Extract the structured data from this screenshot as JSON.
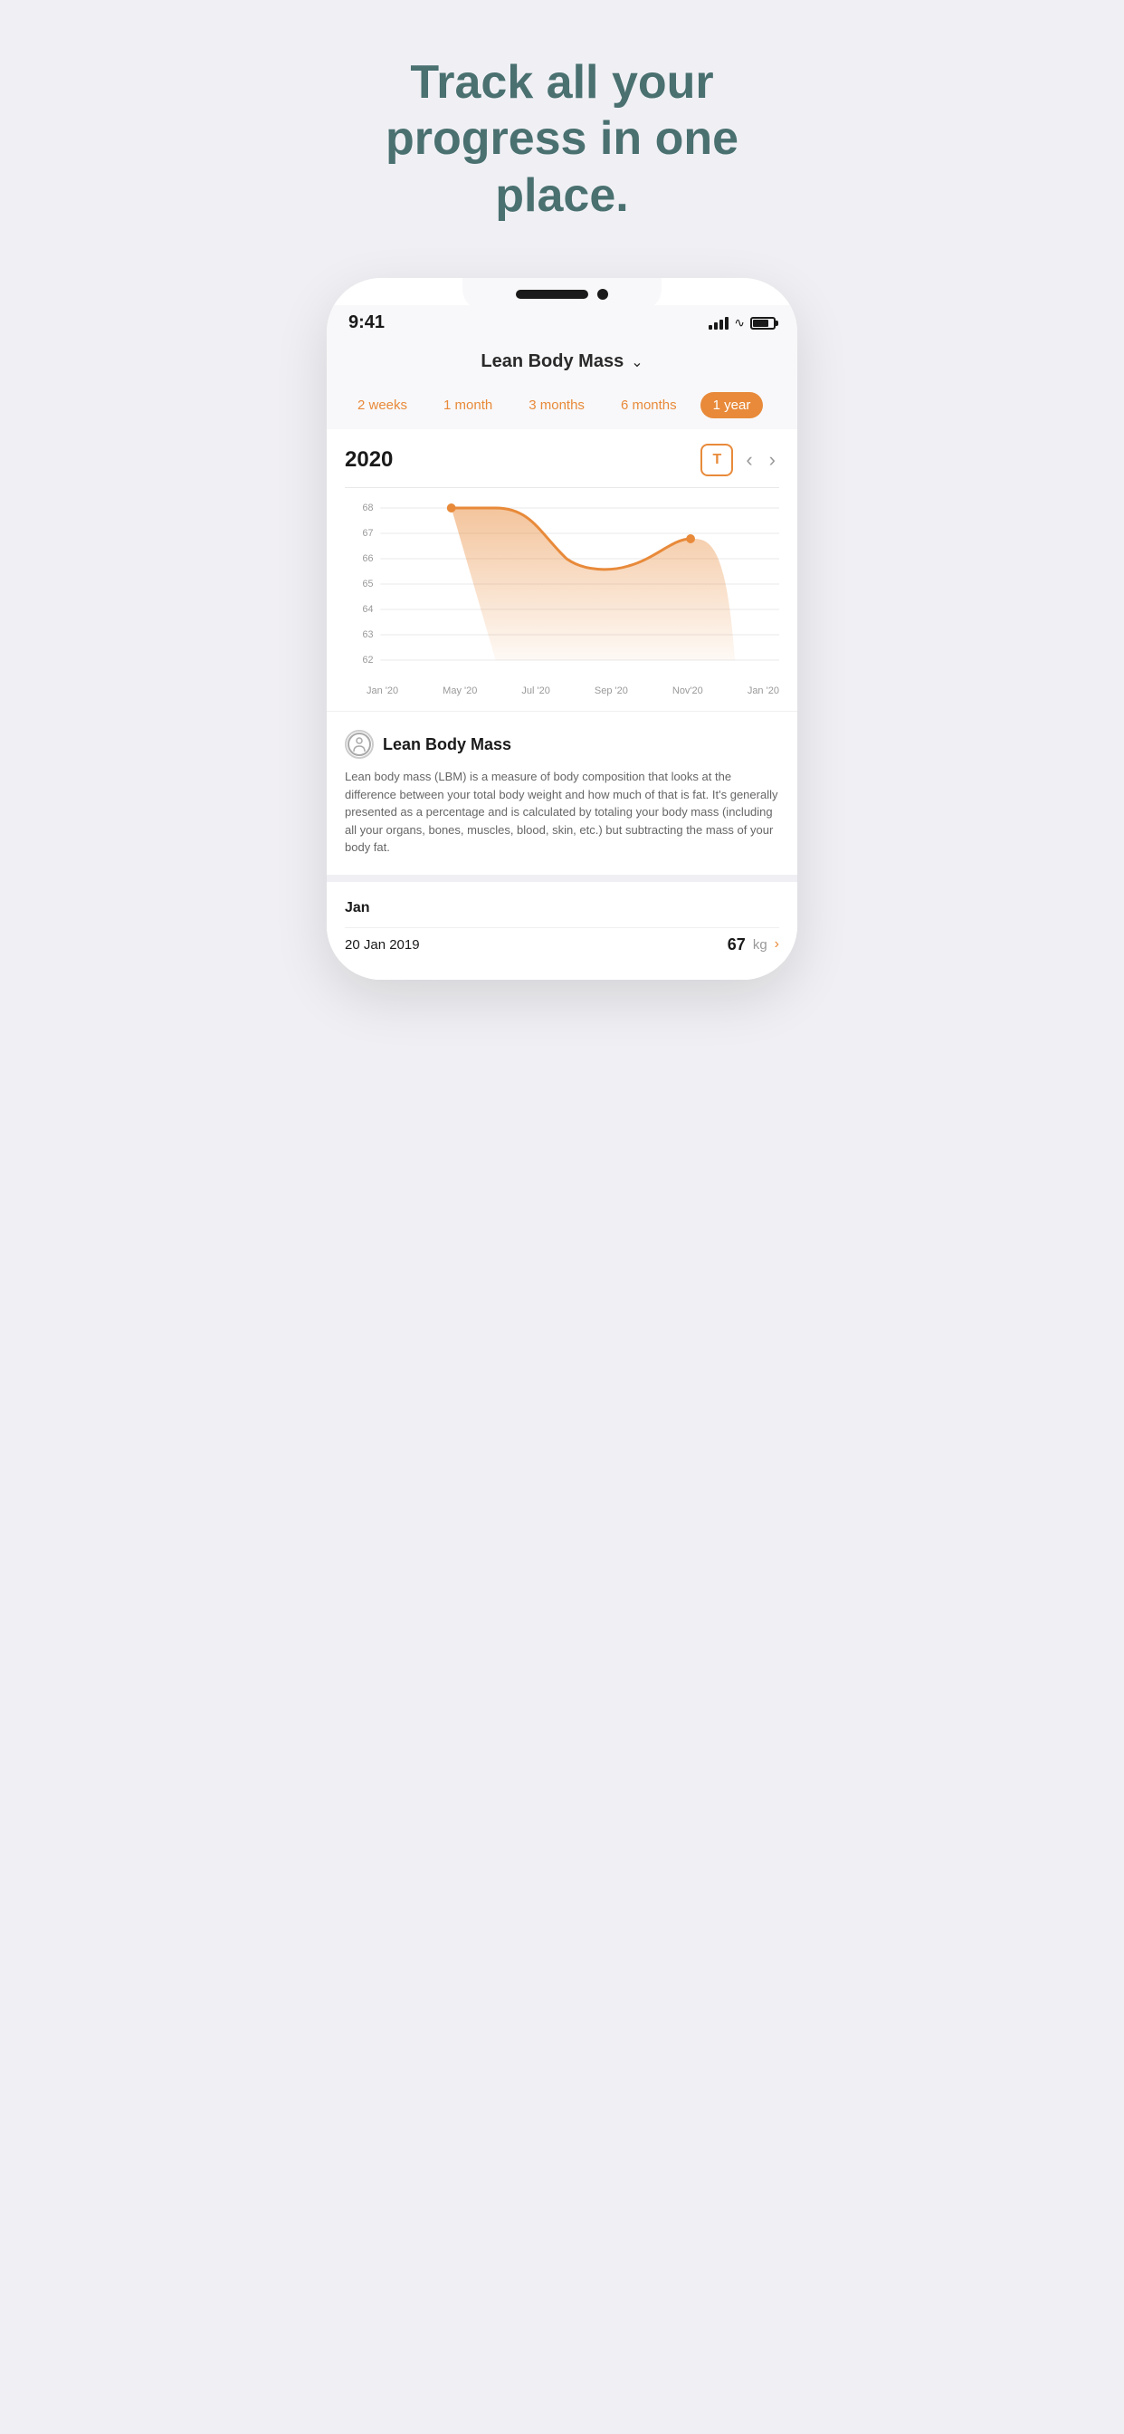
{
  "headline": {
    "line1": "Track all your",
    "line2": "progress in one",
    "line3": "place."
  },
  "status_bar": {
    "time": "9:41"
  },
  "nav": {
    "title": "Lean Body Mass",
    "chevron": "∨"
  },
  "time_tabs": [
    {
      "label": "2 weeks",
      "active": false
    },
    {
      "label": "1 month",
      "active": false
    },
    {
      "label": "3 months",
      "active": false
    },
    {
      "label": "6 months",
      "active": false
    },
    {
      "label": "1 year",
      "active": true
    }
  ],
  "chart": {
    "year": "2020",
    "t_button": "T",
    "x_labels": [
      "Jan '20",
      "May '20",
      "Jul '20",
      "Sep '20",
      "Nov'20",
      "Jan '20"
    ],
    "y_labels": [
      "68",
      "67",
      "66",
      "65",
      "64",
      "63",
      "62"
    ],
    "accent_color": "#e88a3a"
  },
  "info": {
    "icon": "⊙",
    "title": "Lean Body Mass",
    "description": "Lean body mass (LBM) is a measure of body composition that looks at the difference between your total body weight and how much of that is fat. It's generally presented as a percentage and is calculated by totaling your body mass (including all your organs, bones, muscles, blood, skin, etc.) but subtracting the mass of your body fat."
  },
  "data_entries": {
    "month_label": "Jan",
    "entries": [
      {
        "date": "20 Jan 2019",
        "value": "67",
        "unit": "kg"
      }
    ]
  }
}
